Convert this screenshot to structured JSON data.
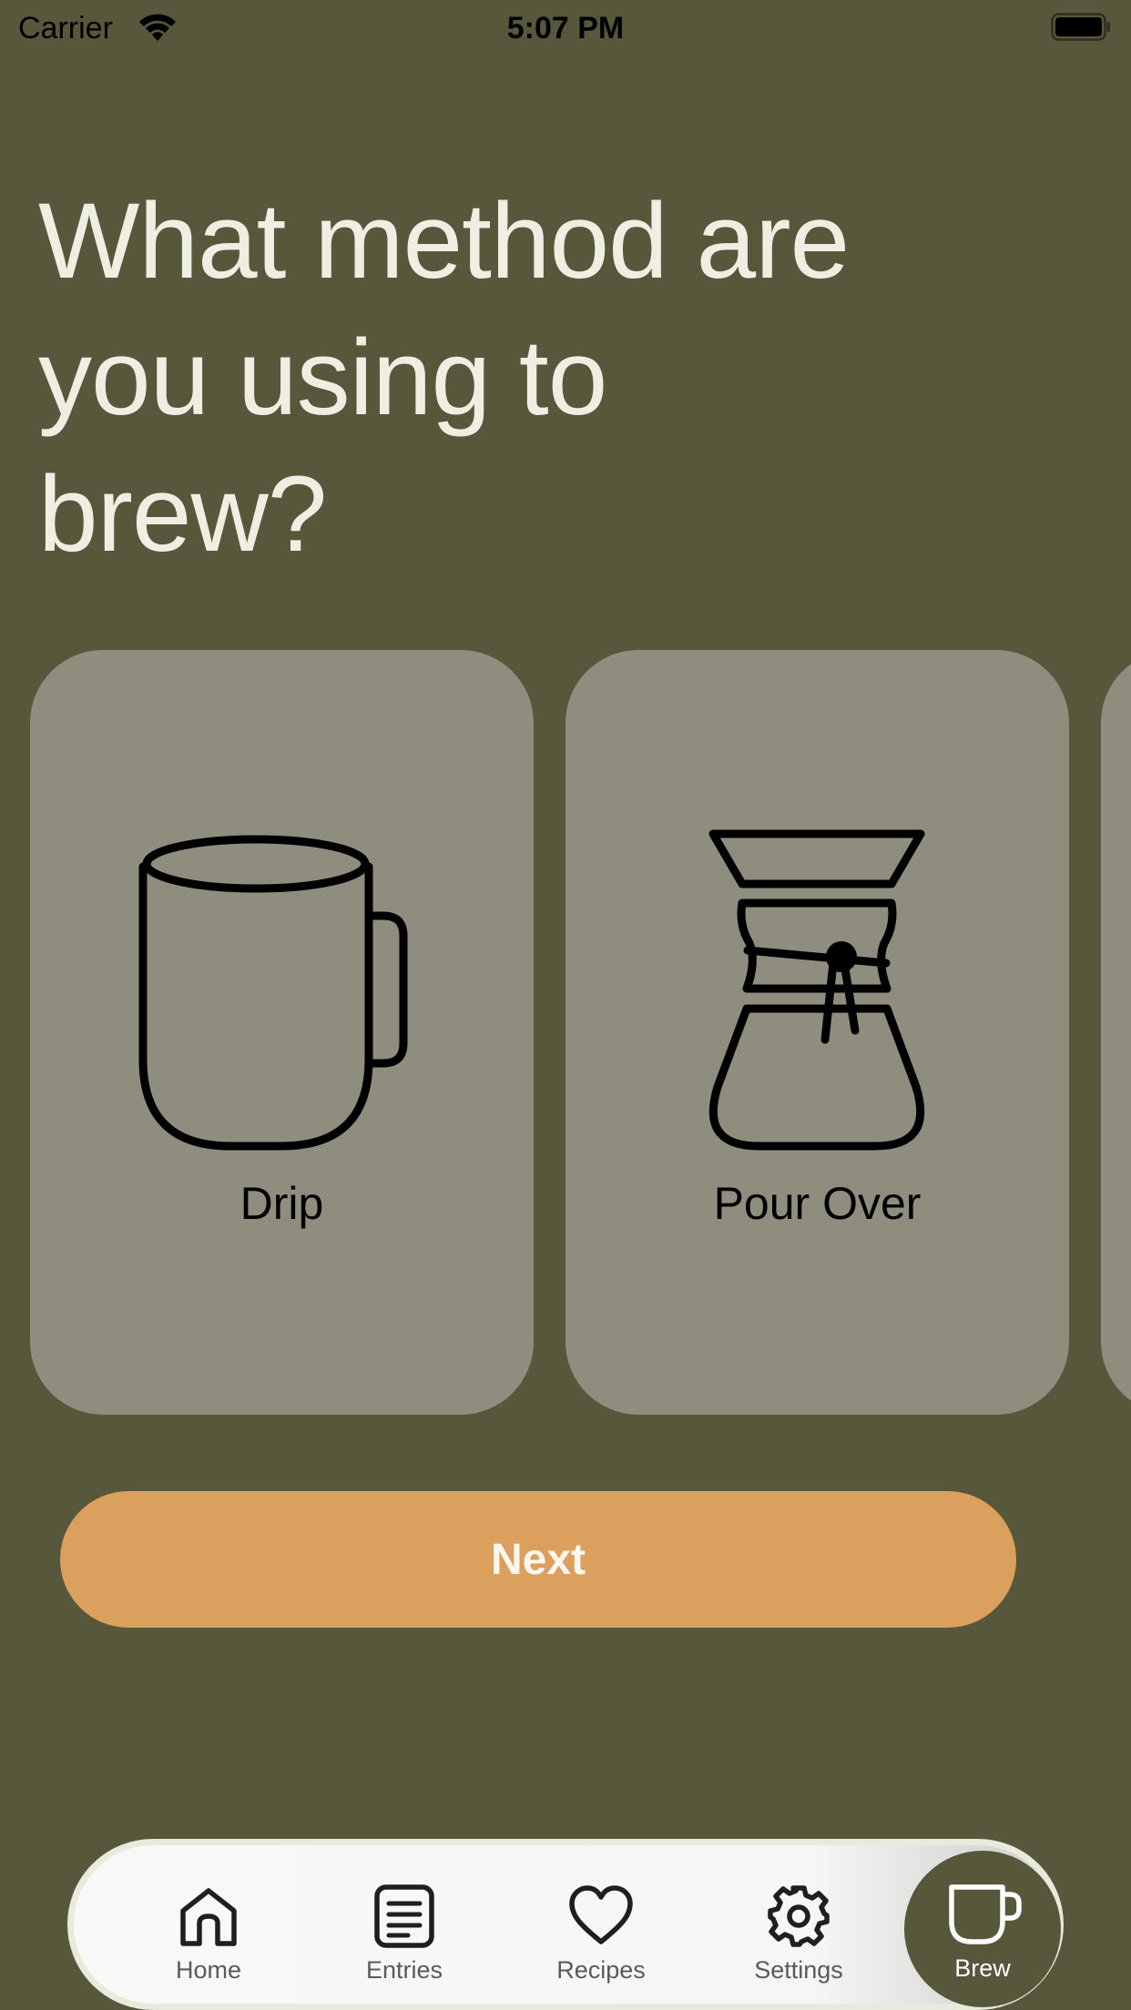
{
  "status_bar": {
    "carrier": "Carrier",
    "time": "5:07 PM",
    "wifi_icon": "wifi-icon",
    "battery_icon": "battery-full-icon"
  },
  "prompt": {
    "line1": "What method are",
    "line2": "you using to",
    "line3": "brew?"
  },
  "methods": [
    {
      "label": "Drip",
      "icon": "mug-icon"
    },
    {
      "label": "Pour Over",
      "icon": "chemex-icon"
    }
  ],
  "next_button": {
    "label": "Next"
  },
  "tab_bar": {
    "tabs": [
      {
        "label": "Home",
        "icon": "home-icon"
      },
      {
        "label": "Entries",
        "icon": "entries-list-icon"
      },
      {
        "label": "Recipes",
        "icon": "heart-icon"
      },
      {
        "label": "Settings",
        "icon": "gear-icon"
      },
      {
        "label": "Brew",
        "icon": "cup-icon",
        "active": true
      }
    ]
  },
  "colors": {
    "background": "#57573c",
    "card": "#8e8d7e",
    "heading_text": "#eeefe2",
    "button": "#dba05e",
    "button_text": "#fbf7ef",
    "tab_bar": "#f6f6f6",
    "tab_bar_border": "#e8eadb"
  }
}
